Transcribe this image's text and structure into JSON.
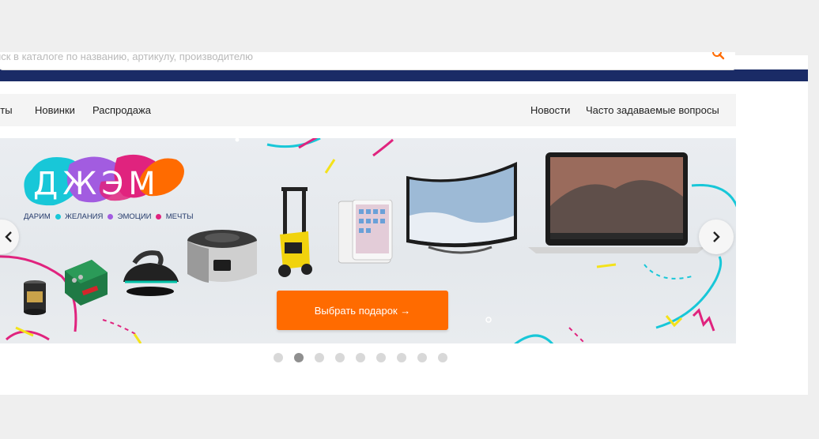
{
  "search": {
    "placeholder": "Поиск в каталоге по названию, артикулу, производителю",
    "visible_text": "иск в каталоге по названию, артикулу, производителю",
    "icon": "search-icon",
    "icon_color": "#ff6b00"
  },
  "nav": {
    "left_items": [
      "Хиты",
      "Новинки",
      "Распродажа"
    ],
    "left_visible": [
      "иты",
      "Новинки",
      "Распродажа"
    ],
    "right_items": [
      "Новости",
      "Часто задаваемые вопросы"
    ]
  },
  "banner": {
    "logo_text": "ДЖЭМ",
    "tagline": [
      {
        "text": "ДАРИМ",
        "dot_color": "#18c7d8"
      },
      {
        "text": "ЖЕЛАНИЯ",
        "dot_color": "#a25ce0"
      },
      {
        "text": "ЭМОЦИИ",
        "dot_color": "#e0237e"
      },
      {
        "text": "МЕЧТЫ",
        "dot_color": ""
      }
    ],
    "cta_label": "Выбрать подарок →",
    "products": [
      "coffee-tin",
      "tool-case",
      "steam-iron",
      "multicooker",
      "pressure-washer",
      "tablet",
      "curved-tv",
      "laptop"
    ]
  },
  "slider": {
    "prev_icon": "chevron-left-icon",
    "next_icon": "chevron-right-icon",
    "total_slides": 9,
    "active_index": 1
  },
  "colors": {
    "brand_navy": "#1a2b66",
    "accent_orange": "#ff6b00",
    "deco_cyan": "#18c7d8",
    "deco_magenta": "#e0237e",
    "deco_yellow": "#f4e21a"
  }
}
